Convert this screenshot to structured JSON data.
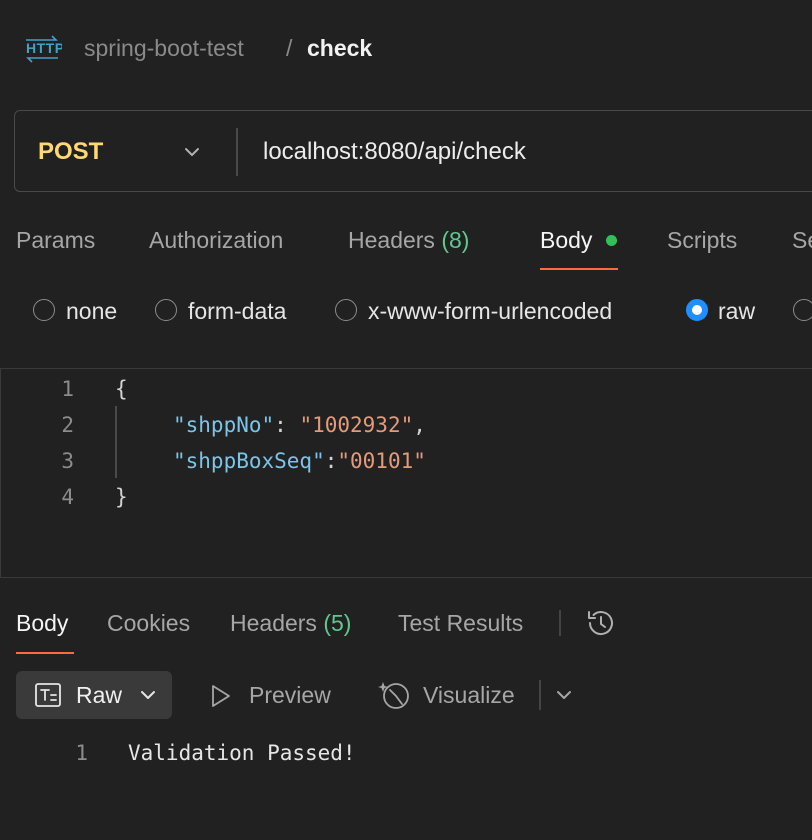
{
  "breadcrumb": {
    "icon": "http-icon",
    "collection": "spring-boot-test",
    "separator": "/",
    "request": "check"
  },
  "request": {
    "method": "POST",
    "method_color": "#ffd773",
    "url": "localhost:8080/api/check"
  },
  "tabs": {
    "params": "Params",
    "authorization": "Authorization",
    "headers": "Headers",
    "headers_count": "(8)",
    "body": "Body",
    "scripts": "Scripts",
    "settings_partial": "Se",
    "active": "Body"
  },
  "body_modes": {
    "none": "none",
    "form_data": "form-data",
    "urlencoded": "x-www-form-urlencoded",
    "raw": "raw",
    "selected": "raw"
  },
  "editor": {
    "line_numbers": [
      "1",
      "2",
      "3",
      "4"
    ],
    "open_brace": "{",
    "close_brace": "}",
    "key1": "\"shppNo\"",
    "sep1": ": ",
    "val1": "\"1002932\"",
    "comma1": ",",
    "key2": "\"shppBoxSeq\"",
    "sep2": ":",
    "val2": "\"00101\""
  },
  "response": {
    "tabs": {
      "body": "Body",
      "cookies": "Cookies",
      "headers": "Headers",
      "headers_count": "(5)",
      "test_results": "Test Results",
      "active": "Body"
    },
    "format": "Raw",
    "preview": "Preview",
    "visualize": "Visualize",
    "line_number": "1",
    "text": "Validation Passed!"
  },
  "colors": {
    "accent_underline": "#ff6c37",
    "status_dot": "#2fc25b",
    "count_green": "#5fc98c",
    "radio_selected": "#1f8fff"
  }
}
